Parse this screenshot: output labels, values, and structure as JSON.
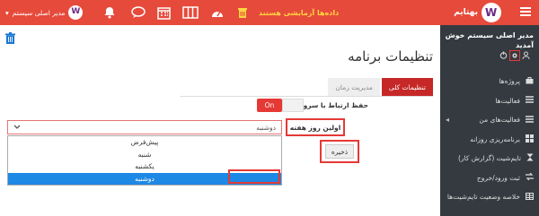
{
  "topbar": {
    "user_label": "مدیر اصلی سیستم",
    "warning": "داده‌ها آزمایشی هستند",
    "brand": "بهتایم",
    "icons": [
      "bell-icon",
      "chat-icon",
      "calendar-icon",
      "columns-icon",
      "dashboard-icon",
      "trash-icon",
      "menu-icon"
    ]
  },
  "sidebar": {
    "greeting": "مدیر اصلی سیستم خوش آمدید",
    "items": [
      {
        "label": "پروژه‌ها",
        "icon": "briefcase-icon"
      },
      {
        "label": "فعالیت‌ها",
        "icon": "list-icon"
      },
      {
        "label": "فعالیت‌های من",
        "icon": "list-icon"
      },
      {
        "label": "برنامه‌ریزی روزانه",
        "icon": "grid-icon"
      },
      {
        "label": "تایم‌شیت (گزارش کار)",
        "icon": "hourglass-icon"
      },
      {
        "label": "ثبت ورود/خروج",
        "icon": "arrows-icon"
      },
      {
        "label": "خلاصه وضعیت تایم‌شیت‌ها",
        "icon": "table-icon"
      }
    ]
  },
  "main": {
    "title": "تنظیمات برنامه",
    "tabs": [
      {
        "label": "تنظیمات کلی",
        "active": true
      },
      {
        "label": "مدیریت زمان",
        "active": false
      }
    ],
    "keep_connection_label": "حفظ ارتباط با سرور",
    "toggle_label": "On",
    "first_day_label": "اولین روز هفته",
    "first_day_value": "دوشنبه",
    "options": [
      "پیش‌فرض",
      "شنبه",
      "یکشنبه",
      "دوشنبه"
    ],
    "selected_option": "دوشنبه",
    "save_label": "ذخیره"
  },
  "colors": {
    "accent": "#e64a3b",
    "sidebar": "#343a40",
    "selected": "#1e88e5"
  }
}
